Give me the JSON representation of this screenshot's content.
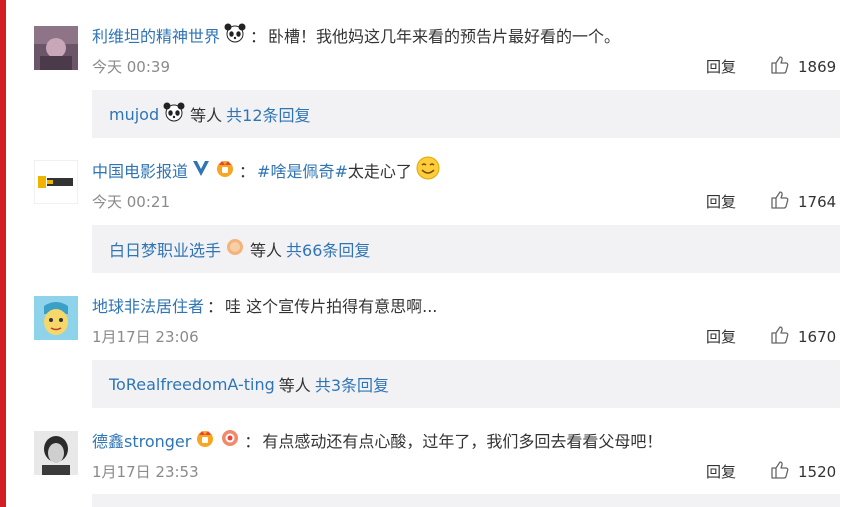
{
  "colors": {
    "accent_red": "#d21f26",
    "link_blue": "#2f75b5",
    "sub_bg": "#f2f2f5"
  },
  "comments": [
    {
      "user": "利维坦的精神世界",
      "badges": [
        "panda-emoji"
      ],
      "colon": "：",
      "hashtag": "",
      "text": "卧槽！我他妈这几年来看的预告片最好看的一个。",
      "time": "今天 00:39",
      "reply_label": "回复",
      "likes": "1869",
      "sub": {
        "user": "mujod",
        "etc": "等人",
        "count": "共12条回复"
      }
    },
    {
      "user": "中国电影报道",
      "badges": [
        "verified-v-icon",
        "crown-badge-icon"
      ],
      "colon": "：",
      "hashtag": "#啥是佩奇#",
      "text": " 太走心了",
      "time": "今天 00:21",
      "reply_label": "回复",
      "likes": "1764",
      "sub": {
        "user": "白日梦职业选手",
        "etc": "等人",
        "count": "共66条回复"
      }
    },
    {
      "user": "地球非法居住者",
      "badges": [],
      "colon": "：",
      "hashtag": "",
      "text": "哇 这个宣传片拍得有意思啊...",
      "time": "1月17日 23:06",
      "reply_label": "回复",
      "likes": "1670",
      "sub": {
        "user": "ToRealfreedomA-ting",
        "etc": "等人",
        "count": "共3条回复"
      }
    },
    {
      "user": "德鑫stronger",
      "badges": [
        "crown-badge-icon",
        "medal-badge-icon"
      ],
      "colon": "：",
      "hashtag": "",
      "text": "有点感动还有点心酸，过年了，我们多回去看看父母吧！",
      "time": "1月17日 23:53",
      "reply_label": "回复",
      "likes": "1520",
      "sub": null
    }
  ]
}
